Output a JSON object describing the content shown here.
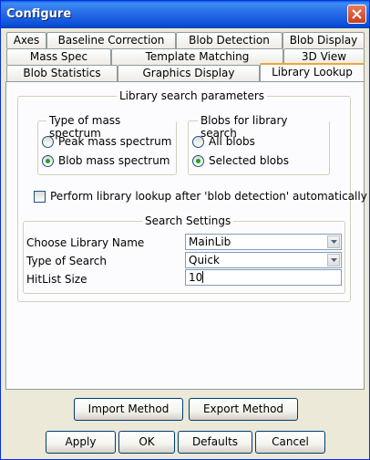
{
  "window": {
    "title": "Configure"
  },
  "tabs": {
    "row1": [
      "Axes",
      "Baseline Correction",
      "Blob Detection",
      "Blob Display"
    ],
    "row2": [
      "Mass Spec",
      "Template Matching",
      "3D View"
    ],
    "row3": [
      "Blob Statistics",
      "Graphics Display",
      "Library Lookup"
    ],
    "active": "Library Lookup"
  },
  "library_search": {
    "title": "Library search parameters",
    "mass_spectrum": {
      "title": "Type of mass spectrum",
      "options": [
        "Peak mass spectrum",
        "Blob mass spectrum"
      ],
      "selected": "Blob mass spectrum"
    },
    "blobs": {
      "title": "Blobs for library search",
      "options": [
        "All blobs",
        "Selected blobs"
      ],
      "selected": "Selected blobs"
    },
    "auto_lookup": {
      "label": "Perform library lookup after 'blob detection' automatically",
      "checked": false
    }
  },
  "search_settings": {
    "title": "Search Settings",
    "library_name_label": "Choose Library Name",
    "library_name_value": "MainLib",
    "search_type_label": "Type of Search",
    "search_type_value": "Quick",
    "hitlist_label": "HitList Size",
    "hitlist_value": "10"
  },
  "buttons": {
    "import_method": "Import Method",
    "export_method": "Export Method",
    "apply": "Apply",
    "ok": "OK",
    "defaults": "Defaults",
    "cancel": "Cancel"
  }
}
